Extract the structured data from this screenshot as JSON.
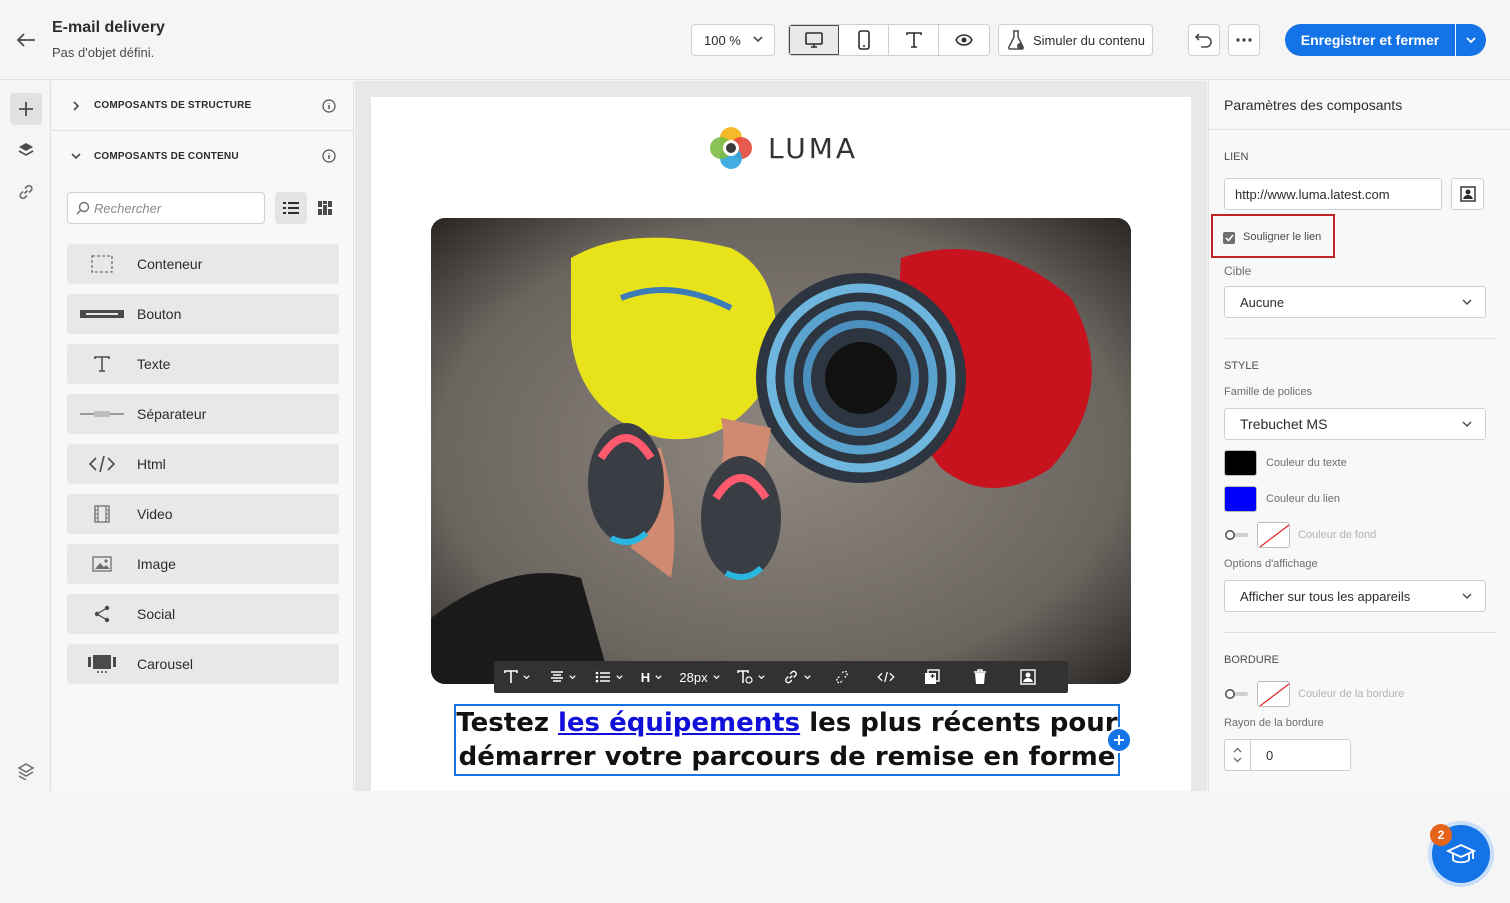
{
  "header": {
    "title": "E-mail delivery",
    "subtitle": "Pas d'objet défini.",
    "zoom": "100 %",
    "simulate_label": "Simuler du contenu",
    "save_label": "Enregistrer et fermer",
    "view_modes": [
      "desktop-icon",
      "mobile-icon",
      "text-icon",
      "preview-eye-icon"
    ]
  },
  "left_panel": {
    "structure_section": "COMPOSANTS DE STRUCTURE",
    "content_section": "COMPOSANTS DE CONTENU",
    "search_placeholder": "Rechercher",
    "components": [
      {
        "label": "Conteneur",
        "icon": "container-icon"
      },
      {
        "label": "Bouton",
        "icon": "button-icon"
      },
      {
        "label": "Texte",
        "icon": "text-icon"
      },
      {
        "label": "Séparateur",
        "icon": "divider-icon"
      },
      {
        "label": "Html",
        "icon": "code-icon"
      },
      {
        "label": "Video",
        "icon": "video-icon"
      },
      {
        "label": "Image",
        "icon": "image-icon"
      },
      {
        "label": "Social",
        "icon": "share-icon"
      },
      {
        "label": "Carousel",
        "icon": "carousel-icon"
      }
    ]
  },
  "email": {
    "logo_text": "LUMA",
    "format_font_size": "28px",
    "text_before": "Testez ",
    "link_text": "les équipements",
    "text_after_link": " les plus récents pour",
    "text_line2": "démarrer votre parcours de remise en forme"
  },
  "right_panel": {
    "title": "Paramètres des composants",
    "link_heading": "LIEN",
    "link_url": "http://www.luma.latest.com",
    "underline_label": "Souligner le lien",
    "underline_checked": true,
    "target_label": "Cible",
    "target_value": "Aucune",
    "style_heading": "STYLE",
    "font_family_label": "Famille de polices",
    "font_family_value": "Trebuchet MS",
    "text_color_label": "Couleur du texte",
    "text_color": "#000000",
    "link_color_label": "Couleur du lien",
    "link_color": "#0000ff",
    "bg_color_label": "Couleur de fond",
    "display_options_label": "Options d'affichage",
    "display_options_value": "Afficher sur tous les appareils",
    "border_heading": "BORDURE",
    "border_color_label": "Couleur de la bordure",
    "border_radius_label": "Rayon de la bordure",
    "border_radius_value": "0"
  },
  "help": {
    "badge_count": "2"
  },
  "colors": {
    "accent": "#1473e6",
    "highlight": "#c02525",
    "badge": "#e5641a"
  }
}
